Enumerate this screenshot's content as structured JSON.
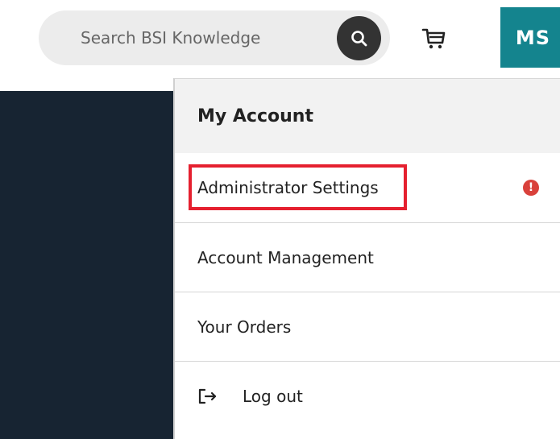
{
  "header": {
    "search": {
      "placeholder": "Search BSI Knowledge",
      "icon": "search-icon"
    },
    "cart_icon": "cart-icon",
    "avatar": {
      "initials": "MS",
      "color": "#14848e"
    }
  },
  "menu": {
    "title": "My Account",
    "items": [
      {
        "label": "Administrator Settings",
        "highlighted": true,
        "badge_icon": "alert-icon",
        "badge_glyph": "!",
        "badge_color": "#d9413b"
      },
      {
        "label": "Account Management"
      },
      {
        "label": "Your Orders"
      },
      {
        "label": "Log out",
        "icon": "log-out-icon"
      }
    ],
    "highlight_color": "#e5202f"
  },
  "colors": {
    "sidebar_dark": "#172432",
    "search_bg": "#ececec",
    "search_button": "#333333"
  }
}
